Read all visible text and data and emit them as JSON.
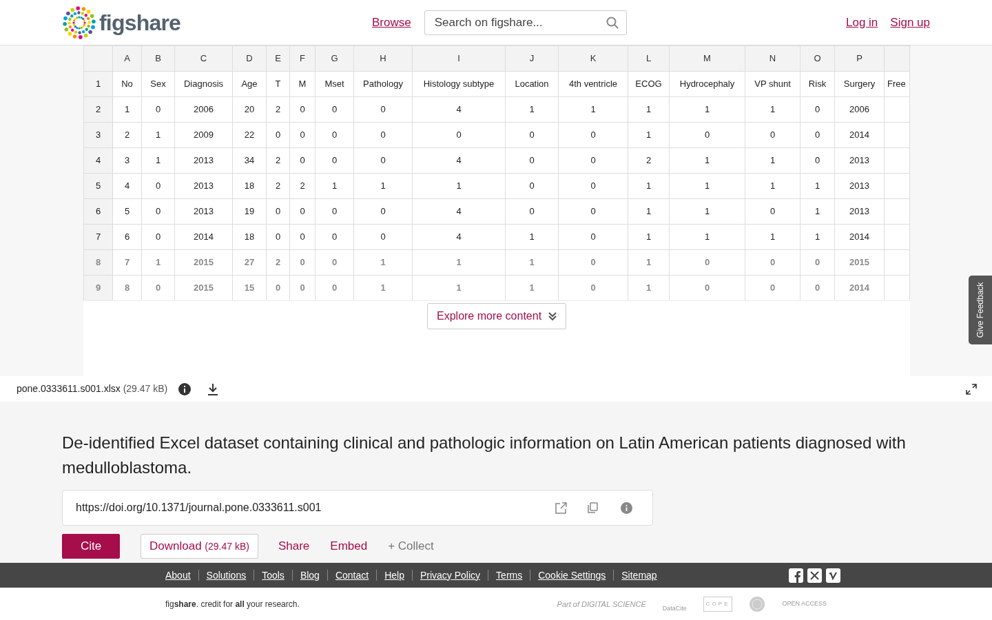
{
  "header": {
    "logo": "figshare",
    "nav": [
      {
        "label": "Browse"
      }
    ],
    "search": {
      "placeholder": "Search on figshare..."
    },
    "auth": [
      {
        "label": "Log in"
      },
      {
        "label": "Sign up"
      }
    ]
  },
  "spreadsheet": {
    "column_letters": [
      "A",
      "B",
      "C",
      "D",
      "E",
      "F",
      "G",
      "H",
      "I",
      "J",
      "K",
      "L",
      "M",
      "N",
      "O",
      "P"
    ],
    "rows": [
      {
        "number": "1",
        "faded": false,
        "cells": [
          "No",
          "Sex",
          "Diagnosis",
          "Age",
          "T",
          "M",
          "Mset",
          "Pathology",
          "Histology subtype",
          "Location",
          "4th ventricle",
          "ECOG",
          "Hydrocephaly",
          "VP shunt",
          "Risk",
          "Surgery",
          "Free"
        ]
      },
      {
        "number": "2",
        "faded": false,
        "cells": [
          "1",
          "0",
          "2006",
          "20",
          "2",
          "0",
          "0",
          "0",
          "4",
          "1",
          "1",
          "1",
          "1",
          "1",
          "0",
          "2006",
          ""
        ]
      },
      {
        "number": "3",
        "faded": false,
        "cells": [
          "2",
          "1",
          "2009",
          "22",
          "0",
          "0",
          "0",
          "0",
          "0",
          "0",
          "0",
          "1",
          "0",
          "0",
          "0",
          "2014",
          ""
        ]
      },
      {
        "number": "4",
        "faded": false,
        "cells": [
          "3",
          "1",
          "2013",
          "34",
          "2",
          "0",
          "0",
          "0",
          "4",
          "0",
          "0",
          "2",
          "1",
          "1",
          "0",
          "2013",
          ""
        ]
      },
      {
        "number": "5",
        "faded": false,
        "cells": [
          "4",
          "0",
          "2013",
          "18",
          "2",
          "2",
          "1",
          "1",
          "1",
          "0",
          "0",
          "1",
          "1",
          "1",
          "1",
          "2013",
          ""
        ]
      },
      {
        "number": "6",
        "faded": false,
        "cells": [
          "5",
          "0",
          "2013",
          "19",
          "0",
          "0",
          "0",
          "0",
          "4",
          "0",
          "0",
          "1",
          "1",
          "0",
          "1",
          "2013",
          ""
        ]
      },
      {
        "number": "7",
        "faded": false,
        "cells": [
          "6",
          "0",
          "2014",
          "18",
          "0",
          "0",
          "0",
          "0",
          "4",
          "1",
          "0",
          "1",
          "1",
          "1",
          "1",
          "2014",
          ""
        ]
      },
      {
        "number": "8",
        "faded": true,
        "cells": [
          "7",
          "1",
          "2015",
          "27",
          "2",
          "0",
          "0",
          "1",
          "1",
          "1",
          "0",
          "1",
          "0",
          "0",
          "0",
          "2015",
          ""
        ]
      },
      {
        "number": "9",
        "faded": true,
        "cells": [
          "8",
          "0",
          "2015",
          "15",
          "0",
          "0",
          "0",
          "1",
          "1",
          "1",
          "0",
          "1",
          "0",
          "0",
          "0",
          "2014",
          ""
        ]
      }
    ],
    "explore_button": "Explore more content"
  },
  "file_bar": {
    "filename": "pone.0333611.s001.xlsx",
    "size": "(29.47 kB)"
  },
  "item": {
    "title": "De-identified Excel dataset containing clinical and pathologic information on Latin American patients diagnosed with medulloblastoma.",
    "doi": "https://doi.org/10.1371/journal.pone.0333611.s001",
    "actions": [
      {
        "kind": "primary",
        "label": "Cite"
      },
      {
        "kind": "outline",
        "label": "Download",
        "extra": "(29.47 kB)"
      },
      {
        "kind": "link",
        "label": "Share"
      },
      {
        "kind": "link",
        "label": "Embed"
      },
      {
        "kind": "muted",
        "label": "+ Collect"
      }
    ]
  },
  "feedback_tab": "Give Feedback",
  "footer": {
    "links": [
      "About",
      "Solutions",
      "Tools",
      "Blog",
      "Contact",
      "Help",
      "Privacy Policy",
      "Terms",
      "Cookie Settings",
      "Sitemap"
    ],
    "tagline": "fig**share**. credit for **all** your research.",
    "partners": [
      {
        "kind": "digital_science",
        "label": "Part of DIGITAL SCIENCE"
      },
      {
        "kind": "datacite",
        "label": "DataCite"
      },
      {
        "kind": "cope",
        "label": "COPE"
      },
      {
        "kind": "seal"
      },
      {
        "kind": "open_access",
        "label": "OPEN ACCESS"
      }
    ]
  }
}
